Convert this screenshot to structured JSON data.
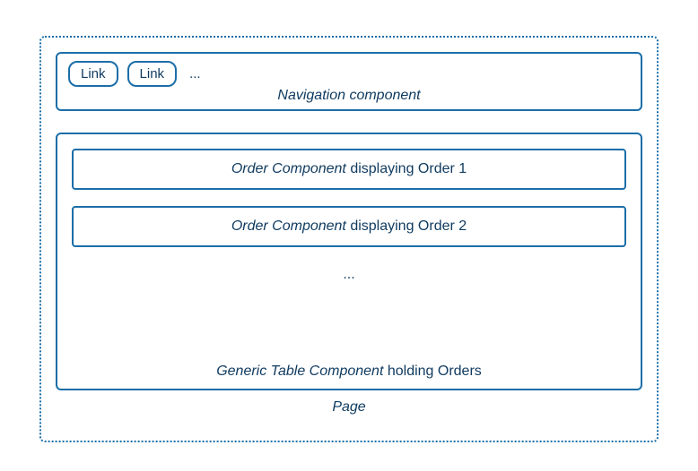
{
  "page": {
    "caption": "Page"
  },
  "nav": {
    "links": [
      "Link",
      "Link"
    ],
    "ellipsis": "...",
    "caption": "Navigation component"
  },
  "table": {
    "order1": {
      "italic": "Order Component",
      "rest": " displaying Order 1"
    },
    "order2": {
      "italic": "Order Component",
      "rest": " displaying Order 2"
    },
    "ellipsis": "...",
    "caption": {
      "italic": "Generic Table Component",
      "rest": " holding Orders"
    }
  }
}
